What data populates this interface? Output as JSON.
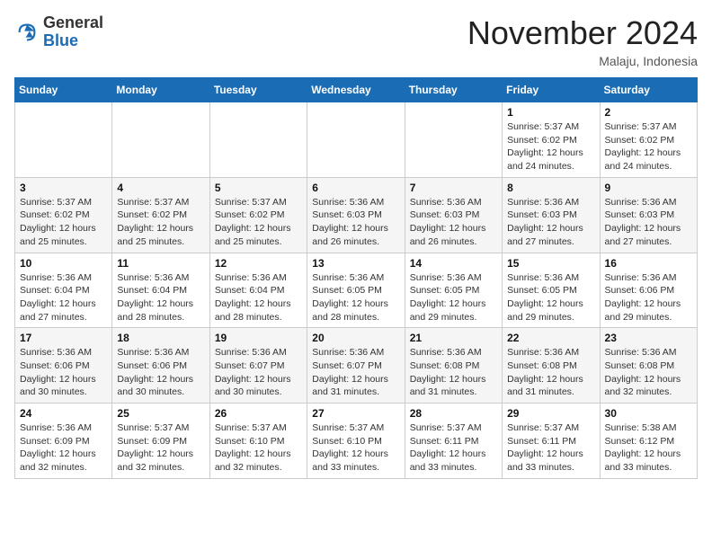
{
  "header": {
    "logo": {
      "general": "General",
      "blue": "Blue"
    },
    "title": "November 2024",
    "location": "Malaju, Indonesia"
  },
  "calendar": {
    "days_of_week": [
      "Sunday",
      "Monday",
      "Tuesday",
      "Wednesday",
      "Thursday",
      "Friday",
      "Saturday"
    ],
    "weeks": [
      [
        {
          "day": "",
          "info": ""
        },
        {
          "day": "",
          "info": ""
        },
        {
          "day": "",
          "info": ""
        },
        {
          "day": "",
          "info": ""
        },
        {
          "day": "",
          "info": ""
        },
        {
          "day": "1",
          "info": "Sunrise: 5:37 AM\nSunset: 6:02 PM\nDaylight: 12 hours and 24 minutes."
        },
        {
          "day": "2",
          "info": "Sunrise: 5:37 AM\nSunset: 6:02 PM\nDaylight: 12 hours and 24 minutes."
        }
      ],
      [
        {
          "day": "3",
          "info": "Sunrise: 5:37 AM\nSunset: 6:02 PM\nDaylight: 12 hours and 25 minutes."
        },
        {
          "day": "4",
          "info": "Sunrise: 5:37 AM\nSunset: 6:02 PM\nDaylight: 12 hours and 25 minutes."
        },
        {
          "day": "5",
          "info": "Sunrise: 5:37 AM\nSunset: 6:02 PM\nDaylight: 12 hours and 25 minutes."
        },
        {
          "day": "6",
          "info": "Sunrise: 5:36 AM\nSunset: 6:03 PM\nDaylight: 12 hours and 26 minutes."
        },
        {
          "day": "7",
          "info": "Sunrise: 5:36 AM\nSunset: 6:03 PM\nDaylight: 12 hours and 26 minutes."
        },
        {
          "day": "8",
          "info": "Sunrise: 5:36 AM\nSunset: 6:03 PM\nDaylight: 12 hours and 27 minutes."
        },
        {
          "day": "9",
          "info": "Sunrise: 5:36 AM\nSunset: 6:03 PM\nDaylight: 12 hours and 27 minutes."
        }
      ],
      [
        {
          "day": "10",
          "info": "Sunrise: 5:36 AM\nSunset: 6:04 PM\nDaylight: 12 hours and 27 minutes."
        },
        {
          "day": "11",
          "info": "Sunrise: 5:36 AM\nSunset: 6:04 PM\nDaylight: 12 hours and 28 minutes."
        },
        {
          "day": "12",
          "info": "Sunrise: 5:36 AM\nSunset: 6:04 PM\nDaylight: 12 hours and 28 minutes."
        },
        {
          "day": "13",
          "info": "Sunrise: 5:36 AM\nSunset: 6:05 PM\nDaylight: 12 hours and 28 minutes."
        },
        {
          "day": "14",
          "info": "Sunrise: 5:36 AM\nSunset: 6:05 PM\nDaylight: 12 hours and 29 minutes."
        },
        {
          "day": "15",
          "info": "Sunrise: 5:36 AM\nSunset: 6:05 PM\nDaylight: 12 hours and 29 minutes."
        },
        {
          "day": "16",
          "info": "Sunrise: 5:36 AM\nSunset: 6:06 PM\nDaylight: 12 hours and 29 minutes."
        }
      ],
      [
        {
          "day": "17",
          "info": "Sunrise: 5:36 AM\nSunset: 6:06 PM\nDaylight: 12 hours and 30 minutes."
        },
        {
          "day": "18",
          "info": "Sunrise: 5:36 AM\nSunset: 6:06 PM\nDaylight: 12 hours and 30 minutes."
        },
        {
          "day": "19",
          "info": "Sunrise: 5:36 AM\nSunset: 6:07 PM\nDaylight: 12 hours and 30 minutes."
        },
        {
          "day": "20",
          "info": "Sunrise: 5:36 AM\nSunset: 6:07 PM\nDaylight: 12 hours and 31 minutes."
        },
        {
          "day": "21",
          "info": "Sunrise: 5:36 AM\nSunset: 6:08 PM\nDaylight: 12 hours and 31 minutes."
        },
        {
          "day": "22",
          "info": "Sunrise: 5:36 AM\nSunset: 6:08 PM\nDaylight: 12 hours and 31 minutes."
        },
        {
          "day": "23",
          "info": "Sunrise: 5:36 AM\nSunset: 6:08 PM\nDaylight: 12 hours and 32 minutes."
        }
      ],
      [
        {
          "day": "24",
          "info": "Sunrise: 5:36 AM\nSunset: 6:09 PM\nDaylight: 12 hours and 32 minutes."
        },
        {
          "day": "25",
          "info": "Sunrise: 5:37 AM\nSunset: 6:09 PM\nDaylight: 12 hours and 32 minutes."
        },
        {
          "day": "26",
          "info": "Sunrise: 5:37 AM\nSunset: 6:10 PM\nDaylight: 12 hours and 32 minutes."
        },
        {
          "day": "27",
          "info": "Sunrise: 5:37 AM\nSunset: 6:10 PM\nDaylight: 12 hours and 33 minutes."
        },
        {
          "day": "28",
          "info": "Sunrise: 5:37 AM\nSunset: 6:11 PM\nDaylight: 12 hours and 33 minutes."
        },
        {
          "day": "29",
          "info": "Sunrise: 5:37 AM\nSunset: 6:11 PM\nDaylight: 12 hours and 33 minutes."
        },
        {
          "day": "30",
          "info": "Sunrise: 5:38 AM\nSunset: 6:12 PM\nDaylight: 12 hours and 33 minutes."
        }
      ]
    ]
  }
}
